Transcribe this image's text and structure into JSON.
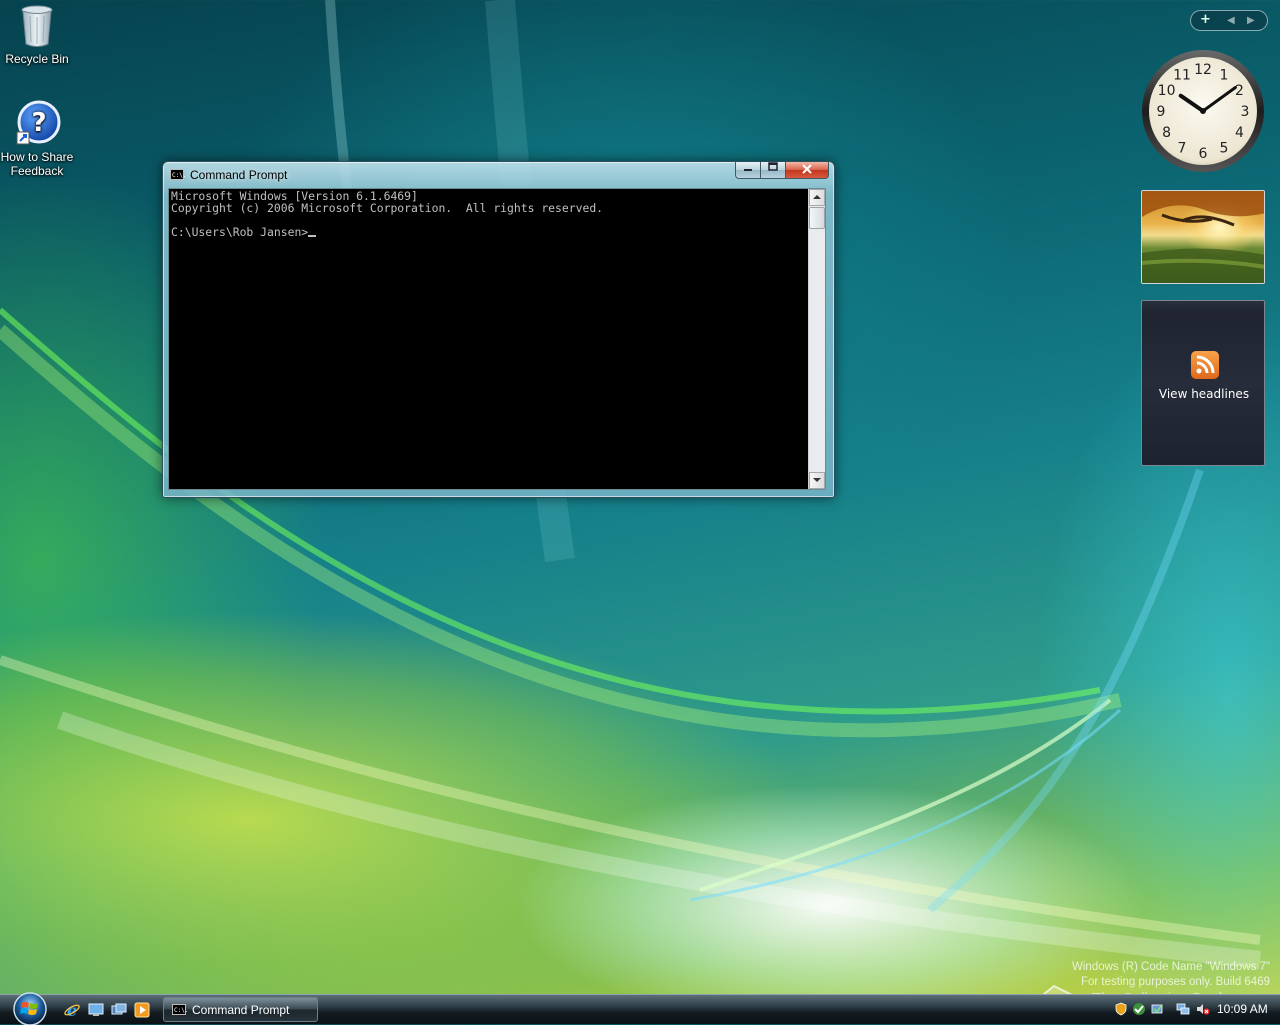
{
  "desktop": {
    "icons": [
      {
        "label": "Recycle Bin"
      },
      {
        "label": "How to Share Feedback"
      }
    ]
  },
  "window": {
    "title": "Command Prompt",
    "icon_text": "C:\\.",
    "console_lines": [
      "Microsoft Windows [Version 6.1.6469]",
      "Copyright (c) 2006 Microsoft Corporation.  All rights reserved.",
      "",
      "C:\\Users\\Rob Jansen>"
    ]
  },
  "sidebar": {
    "clock": {
      "numerals": [
        "12",
        "1",
        "2",
        "3",
        "4",
        "5",
        "6",
        "7",
        "8",
        "9",
        "10",
        "11"
      ],
      "hour": 10,
      "minute": 9
    },
    "feed_gadget": {
      "label": "View headlines"
    }
  },
  "watermark": {
    "line1": "Windows (R) Code Name \"Windows 7\"",
    "line2": "For testing purposes only. Build 6469",
    "overlay": "The Collection Book"
  },
  "taskbar": {
    "task_button_label": "Command Prompt",
    "clock_time": "10:09 AM"
  },
  "colors": {
    "console_bg": "#000000",
    "console_fg": "#c0c0c0",
    "close_button": "#c3361d",
    "feed_orange": "#f7a24a"
  }
}
